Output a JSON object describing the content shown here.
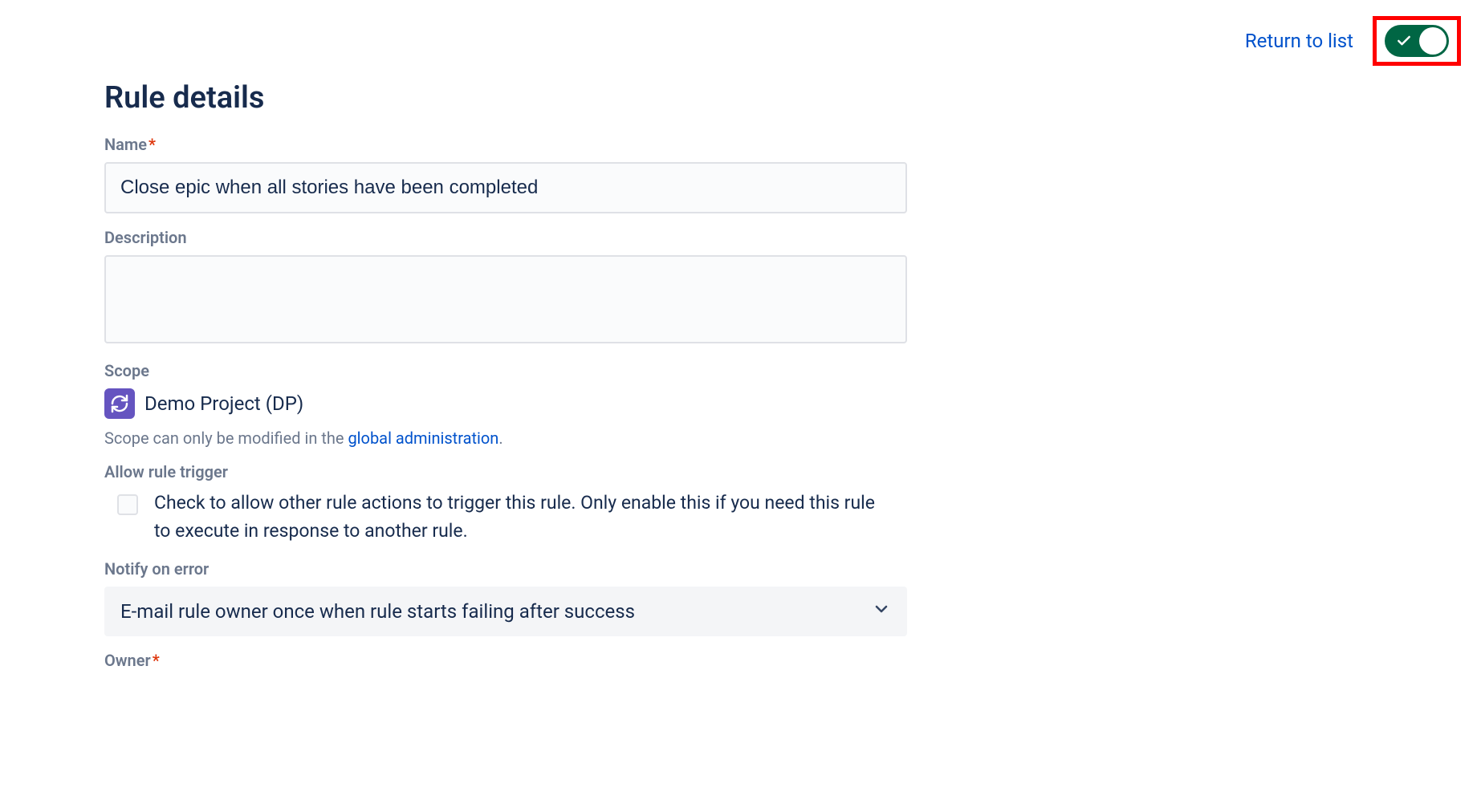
{
  "header": {
    "return_link": "Return to list",
    "toggle_state": "on"
  },
  "page_title": "Rule details",
  "fields": {
    "name": {
      "label": "Name",
      "required": true,
      "value": "Close epic when all stories have been completed"
    },
    "description": {
      "label": "Description",
      "value": ""
    },
    "scope": {
      "label": "Scope",
      "project_name": "Demo Project (DP)",
      "help_prefix": "Scope can only be modified in the ",
      "help_link": "global administration",
      "help_suffix": "."
    },
    "allow_trigger": {
      "label": "Allow rule trigger",
      "checked": false,
      "help": "Check to allow other rule actions to trigger this rule. Only enable this if you need this rule to execute in response to another rule."
    },
    "notify_error": {
      "label": "Notify on error",
      "selected": "E-mail rule owner once when rule starts failing after success"
    },
    "owner": {
      "label": "Owner",
      "required": true
    }
  }
}
